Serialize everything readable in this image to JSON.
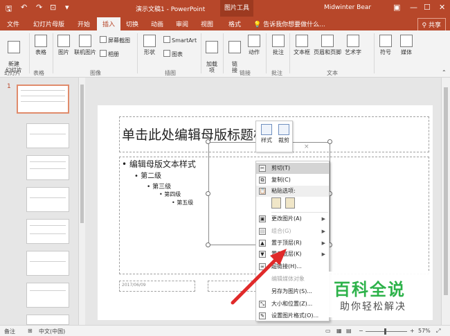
{
  "titlebar": {
    "quick_access": [
      "save-icon",
      "undo-icon",
      "redo-icon",
      "present-icon",
      "customize-icon"
    ],
    "doc_title": "演示文稿1 - PowerPoint",
    "context_tool": "图片工具",
    "user": "Midwinter Bear",
    "restore_icon": "▣",
    "minimize_icon": "—",
    "maximize_icon": "☐",
    "close_icon": "✕"
  },
  "tabs": [
    {
      "label": "文件"
    },
    {
      "label": "幻灯片母版"
    },
    {
      "label": "开始"
    },
    {
      "label": "插入"
    },
    {
      "label": "切换"
    },
    {
      "label": "动画"
    },
    {
      "label": "审阅"
    },
    {
      "label": "视图"
    },
    {
      "label": "格式"
    }
  ],
  "tell_me": "告诉我你想要做什么...",
  "share": "共享",
  "ribbon": {
    "new_slide": "新建\n幻灯片",
    "table": "表格",
    "picture": "图片",
    "online_picture": "联机图片",
    "screenshot": "屏幕截图",
    "album": "相册",
    "shapes": "形状",
    "smartart": "SmartArt",
    "chart": "图表",
    "addins": "加载\n项",
    "link": "链\n接",
    "action": "动作",
    "comment": "批注",
    "textbox": "文本框",
    "header_footer": "页眉和页脚",
    "wordart": "艺术字",
    "symbol": "符号",
    "media": "媒体",
    "groups": {
      "slides": "幻灯片",
      "tables": "表格",
      "images": "图像",
      "illustrations": "插图",
      "links": "链接",
      "comments": "批注",
      "text": "文本"
    }
  },
  "thumbnails": {
    "first_number": "1"
  },
  "slide": {
    "title": "单击此处编辑母版标题样式",
    "levels": [
      "• 编辑母版文本样式",
      "• 第二级",
      "• 第三级",
      "• 第四级",
      "• 第五级"
    ],
    "date": "2017/06/09"
  },
  "mini_toolbar": {
    "style": "样式",
    "crop": "裁剪"
  },
  "context_menu": {
    "items": [
      {
        "label": "剪切(T)",
        "icon": "✂"
      },
      {
        "label": "复制(C)",
        "icon": "⧉"
      },
      {
        "label": "粘贴选项:",
        "icon": "📋"
      },
      {
        "label": "更改图片(A)",
        "icon": "▣"
      },
      {
        "label": "组合(G)",
        "icon": "▤"
      },
      {
        "label": "置于顶层(R)",
        "icon": "▲"
      },
      {
        "label": "置于底层(K)",
        "icon": "▼"
      },
      {
        "label": "超链接(H)...",
        "icon": "∞"
      },
      {
        "label": "编辑媒体对象",
        "icon": ""
      },
      {
        "label": "另存为图片(S)...",
        "icon": ""
      },
      {
        "label": "大小和位置(Z)...",
        "icon": "⤡"
      },
      {
        "label": "设置图片格式(O)...",
        "icon": "✎"
      }
    ]
  },
  "watermark": {
    "main": "百科全说",
    "sub": "助你轻松解决"
  },
  "status": {
    "notes": "备注",
    "language": "中文(中国)",
    "zoom": "57%"
  },
  "colors": {
    "accent": "#b7472a",
    "watermark_green": "#2db24a",
    "arrow_red": "#e02a2a"
  }
}
